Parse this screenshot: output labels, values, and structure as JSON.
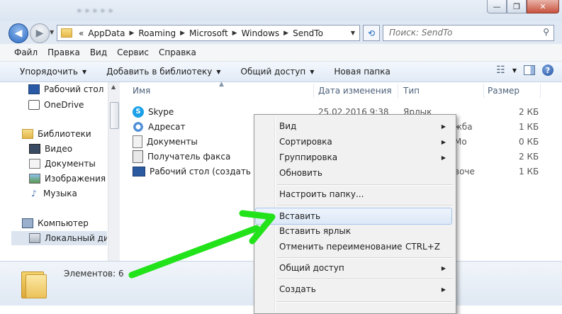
{
  "window": {
    "close_glyph": "✕",
    "max_glyph": "❐",
    "min_glyph": "—"
  },
  "address": {
    "crumbs": [
      "AppData",
      "Roaming",
      "Microsoft",
      "Windows",
      "SendTo"
    ],
    "search_placeholder": "Поиск: SendTo",
    "overflow": "«"
  },
  "menubar": [
    "Файл",
    "Правка",
    "Вид",
    "Сервис",
    "Справка"
  ],
  "commands": [
    "Упорядочить",
    "Добавить в библиотеку",
    "Общий доступ",
    "Новая папка"
  ],
  "nav": {
    "items": [
      {
        "label": "Рабочий стол",
        "icon": "desktop-icon"
      },
      {
        "label": "OneDrive",
        "icon": "onedrive-icon"
      },
      {
        "label": "Библиотеки",
        "icon": "libraries-icon"
      },
      {
        "label": "Видео",
        "icon": "video-icon"
      },
      {
        "label": "Документы",
        "icon": "documents-icon"
      },
      {
        "label": "Изображения",
        "icon": "pictures-icon"
      },
      {
        "label": "Музыка",
        "icon": "music-icon"
      },
      {
        "label": "Компьютер",
        "icon": "computer-icon"
      },
      {
        "label": "Локальный диск",
        "icon": "local-disk-icon"
      }
    ]
  },
  "columns": {
    "name": "Имя",
    "date": "Дата изменения",
    "type": "Тип",
    "size": "Размер"
  },
  "files": [
    {
      "name": "Skype",
      "date": "25.02.2016 9:38",
      "type": "Ярлык",
      "size": "2 КБ",
      "icon": "skype-shortcut-icon"
    },
    {
      "name": "Адресат",
      "date": "",
      "type": "жба",
      "size": "1 КБ",
      "icon": "mail-recipient-icon"
    },
    {
      "name": "Документы",
      "date": "",
      "type": "Мо",
      "size": "0 КБ",
      "icon": "documents-icon"
    },
    {
      "name": "Получатель факса",
      "date": "",
      "type": "",
      "size": "2 КБ",
      "icon": "fax-icon"
    },
    {
      "name": "Рабочий стол (создать ярлык)",
      "date": "",
      "type": "воче",
      "size": "1 КБ",
      "icon": "desktop-shortcut-icon"
    }
  ],
  "status": {
    "count_text": "Элементов: 6"
  },
  "context_menu": {
    "items": [
      {
        "label": "Вид",
        "submenu": true
      },
      {
        "label": "Сортировка",
        "submenu": true
      },
      {
        "label": "Группировка",
        "submenu": true
      },
      {
        "label": "Обновить"
      },
      {
        "label": "Настроить папку..."
      },
      {
        "label": "Вставить",
        "highlighted": true
      },
      {
        "label": "Вставить ярлык"
      },
      {
        "label": "Отменить переименование",
        "shortcut": "CTRL+Z"
      },
      {
        "label": "Общий доступ",
        "submenu": true
      },
      {
        "label": "Создать",
        "submenu": true
      }
    ]
  },
  "colors": {
    "arrow": "#22e31a",
    "highlight_border": "#a8c4ea"
  }
}
